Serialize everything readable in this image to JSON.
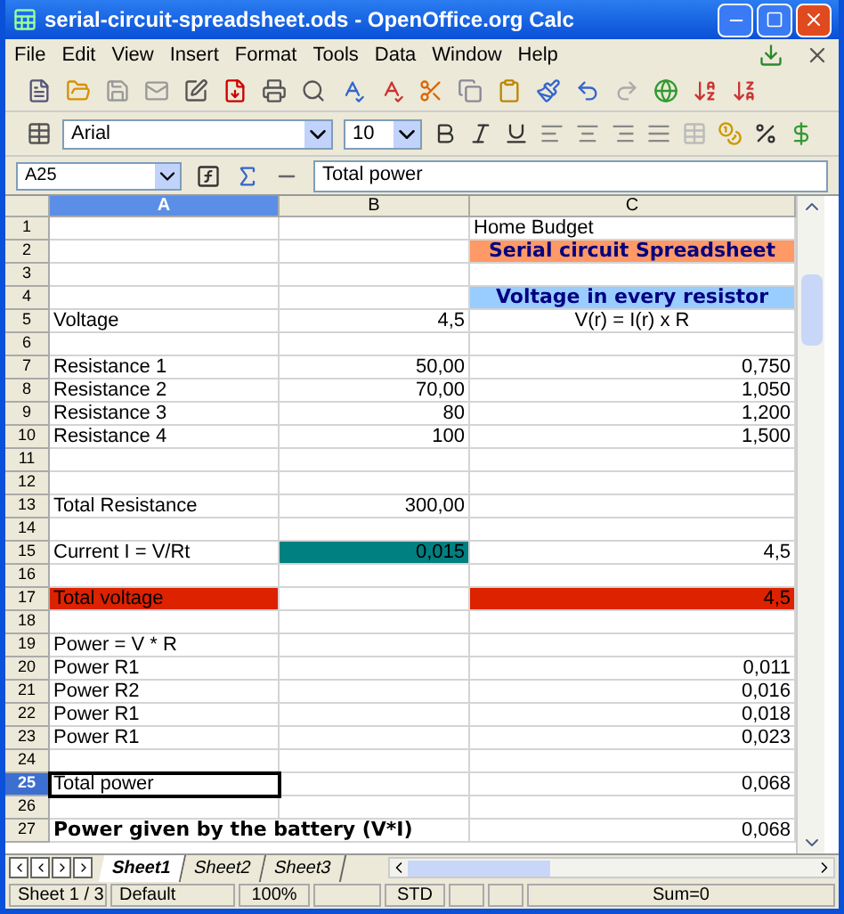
{
  "window": {
    "title": "serial-circuit-spreadsheet.ods - OpenOffice.org Calc"
  },
  "menu": [
    "File",
    "Edit",
    "View",
    "Insert",
    "Format",
    "Tools",
    "Data",
    "Window",
    "Help"
  ],
  "formatting": {
    "font": "Arial",
    "size": "10"
  },
  "formula_bar": {
    "cell_ref": "A25",
    "value": "Total power"
  },
  "columns": [
    {
      "label": "A",
      "selected": true
    },
    {
      "label": "B",
      "selected": false
    },
    {
      "label": "C",
      "selected": false
    }
  ],
  "rows": [
    {
      "number": "1",
      "selected": false,
      "cells": [
        null,
        null,
        {
          "text": "Home Budget",
          "kind": "label"
        }
      ]
    },
    {
      "number": "2",
      "selected": false,
      "cells": [
        null,
        null,
        {
          "text": "Serial circuit Spreadsheet",
          "kind": "heading",
          "color": "#ff9966"
        }
      ]
    },
    {
      "number": "3",
      "selected": false,
      "cells": [
        null,
        null,
        null
      ]
    },
    {
      "number": "4",
      "selected": false,
      "cells": [
        null,
        null,
        {
          "text": "Voltage in every resistor",
          "kind": "heading",
          "color": "#99ccff"
        }
      ]
    },
    {
      "number": "5",
      "selected": false,
      "cells": [
        {
          "text": "Voltage",
          "kind": "label"
        },
        {
          "text": "4,5",
          "kind": "number"
        },
        {
          "text": "V(r) = I(r) x R",
          "kind": "center"
        }
      ]
    },
    {
      "number": "6",
      "selected": false,
      "cells": [
        null,
        null,
        null
      ]
    },
    {
      "number": "7",
      "selected": false,
      "cells": [
        {
          "text": "Resistance 1",
          "kind": "label"
        },
        {
          "text": "50,00",
          "kind": "number"
        },
        {
          "text": "0,750",
          "kind": "number"
        }
      ]
    },
    {
      "number": "8",
      "selected": false,
      "cells": [
        {
          "text": "Resistance 2",
          "kind": "label"
        },
        {
          "text": "70,00",
          "kind": "number"
        },
        {
          "text": "1,050",
          "kind": "number"
        }
      ]
    },
    {
      "number": "9",
      "selected": false,
      "cells": [
        {
          "text": "Resistance 3",
          "kind": "label"
        },
        {
          "text": "80",
          "kind": "number"
        },
        {
          "text": "1,200",
          "kind": "number"
        }
      ]
    },
    {
      "number": "10",
      "selected": false,
      "cells": [
        {
          "text": "Resistance 4",
          "kind": "label"
        },
        {
          "text": "100",
          "kind": "number"
        },
        {
          "text": "1,500",
          "kind": "number"
        }
      ]
    },
    {
      "number": "11",
      "selected": false,
      "cells": [
        null,
        null,
        null
      ]
    },
    {
      "number": "12",
      "selected": false,
      "cells": [
        null,
        null,
        null
      ]
    },
    {
      "number": "13",
      "selected": false,
      "cells": [
        {
          "text": "Total Resistance",
          "kind": "label"
        },
        {
          "text": "300,00",
          "kind": "number"
        },
        null
      ]
    },
    {
      "number": "14",
      "selected": false,
      "cells": [
        null,
        null,
        null
      ]
    },
    {
      "number": "15",
      "selected": false,
      "cells": [
        {
          "text": "Current I = V/Rt",
          "kind": "label"
        },
        {
          "text": "0,015",
          "kind": "number",
          "color": "#008080"
        },
        {
          "text": "4,5",
          "kind": "number"
        }
      ]
    },
    {
      "number": "16",
      "selected": false,
      "cells": [
        null,
        null,
        null
      ]
    },
    {
      "number": "17",
      "selected": false,
      "cells": [
        {
          "text": "Total voltage",
          "kind": "label",
          "color": "#dd2200"
        },
        null,
        {
          "text": "4,5",
          "kind": "number",
          "color": "#dd2200"
        }
      ]
    },
    {
      "number": "18",
      "selected": false,
      "cells": [
        null,
        null,
        null
      ]
    },
    {
      "number": "19",
      "selected": false,
      "cells": [
        {
          "text": "Power = V * R",
          "kind": "label"
        },
        null,
        null
      ]
    },
    {
      "number": "20",
      "selected": false,
      "cells": [
        {
          "text": "Power R1",
          "kind": "label"
        },
        null,
        {
          "text": "0,011",
          "kind": "number"
        }
      ]
    },
    {
      "number": "21",
      "selected": false,
      "cells": [
        {
          "text": "Power R2",
          "kind": "label"
        },
        null,
        {
          "text": "0,016",
          "kind": "number"
        }
      ]
    },
    {
      "number": "22",
      "selected": false,
      "cells": [
        {
          "text": "Power R1",
          "kind": "label"
        },
        null,
        {
          "text": "0,018",
          "kind": "number"
        }
      ]
    },
    {
      "number": "23",
      "selected": false,
      "cells": [
        {
          "text": "Power R1",
          "kind": "label"
        },
        null,
        {
          "text": "0,023",
          "kind": "number"
        }
      ]
    },
    {
      "number": "24",
      "selected": false,
      "cells": [
        null,
        null,
        null
      ]
    },
    {
      "number": "25",
      "selected": true,
      "cells": [
        {
          "text": "Total power",
          "kind": "label",
          "selected": true
        },
        null,
        {
          "text": "0,068",
          "kind": "number"
        }
      ]
    },
    {
      "number": "26",
      "selected": false,
      "cells": [
        null,
        null,
        null
      ]
    },
    {
      "number": "27",
      "selected": false,
      "cells": [
        {
          "text": "Power given by the battery (V*I)",
          "kind": "bold"
        },
        null,
        {
          "text": "0,068",
          "kind": "number"
        }
      ]
    }
  ],
  "sheet_tabs": [
    {
      "label": "Sheet1",
      "selected": true
    },
    {
      "label": "Sheet2",
      "selected": false
    },
    {
      "label": "Sheet3",
      "selected": false
    }
  ],
  "status_bar": [
    "Sheet 1 / 3",
    "Default",
    "100%",
    "STD",
    "Sum=0"
  ]
}
